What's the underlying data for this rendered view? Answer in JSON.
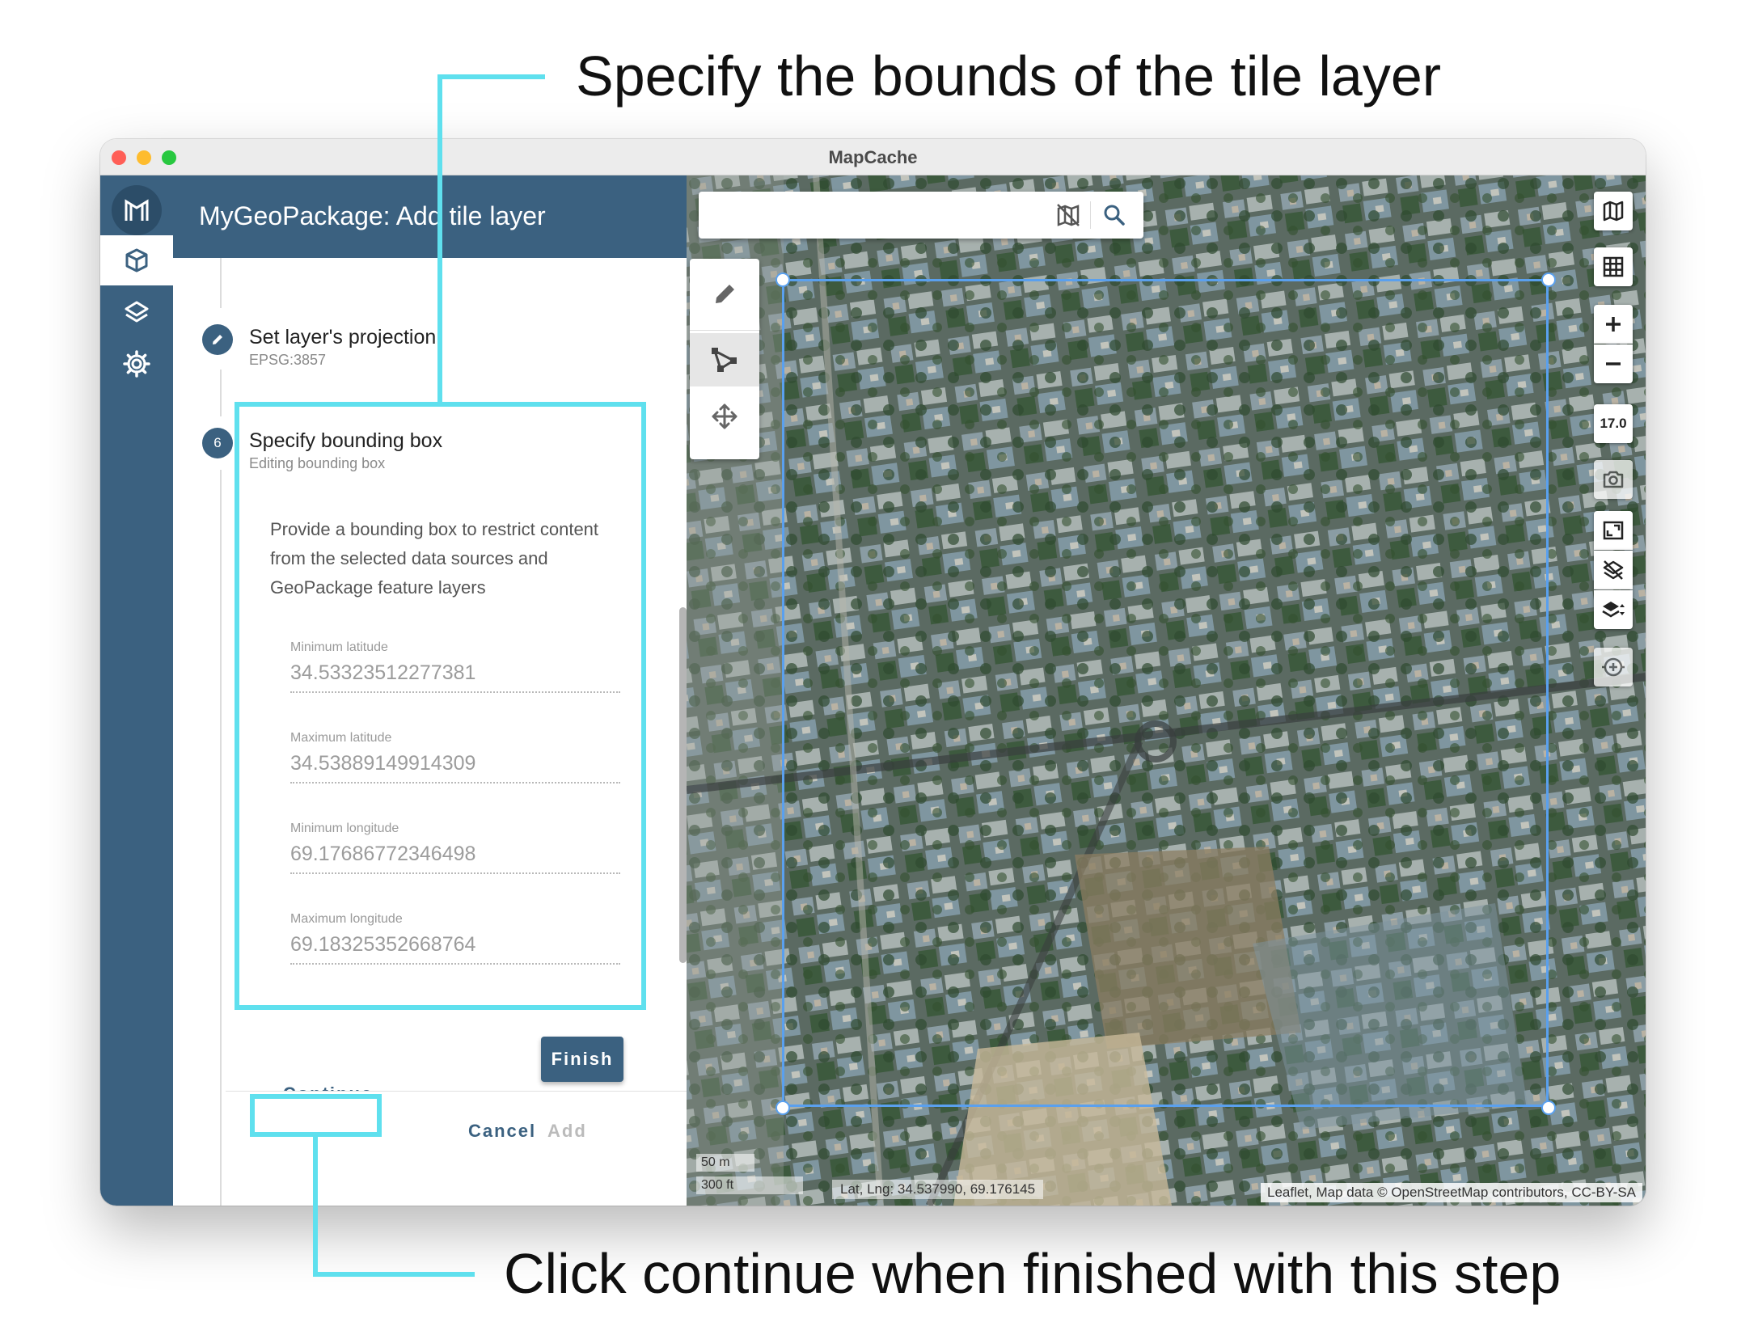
{
  "callouts": {
    "top": "Specify the bounds of the tile layer",
    "bottom": "Click continue when finished with this step"
  },
  "window": {
    "title": "MapCache"
  },
  "header": {
    "title": "MyGeoPackage: Add tile layer"
  },
  "nav": {
    "items": [
      "tile-layer",
      "layers",
      "settings"
    ]
  },
  "steps": {
    "projection": {
      "title": "Set layer's projection",
      "subtitle": "EPSG:3857"
    },
    "bbox": {
      "number": "6",
      "title": "Specify bounding box",
      "subtitle": "Editing bounding box",
      "description": "Provide a bounding box to restrict content from the selected data sources and GeoPackage feature layers",
      "fields": [
        {
          "label": "Minimum latitude",
          "value": "34.53323512277381"
        },
        {
          "label": "Maximum latitude",
          "value": "34.53889149914309"
        },
        {
          "label": "Minimum longitude",
          "value": "69.17686772346498"
        },
        {
          "label": "Maximum longitude",
          "value": "69.18325352668764"
        }
      ]
    }
  },
  "buttons": {
    "finish": "Finish",
    "continue": "Continue",
    "cancel": "Cancel",
    "add": "Add"
  },
  "map": {
    "zoom": "17.0",
    "scale_metric": "50 m",
    "scale_imperial": "300 ft",
    "latlng": "Lat, Lng: 34.537990, 69.176145",
    "attribution": "Leaflet, Map data © OpenStreetMap contributors, CC-BY-SA",
    "search_placeholder": ""
  },
  "colors": {
    "primary": "#3b6180",
    "highlight": "#5fe0ee",
    "bbox": "#5aa0ee"
  }
}
